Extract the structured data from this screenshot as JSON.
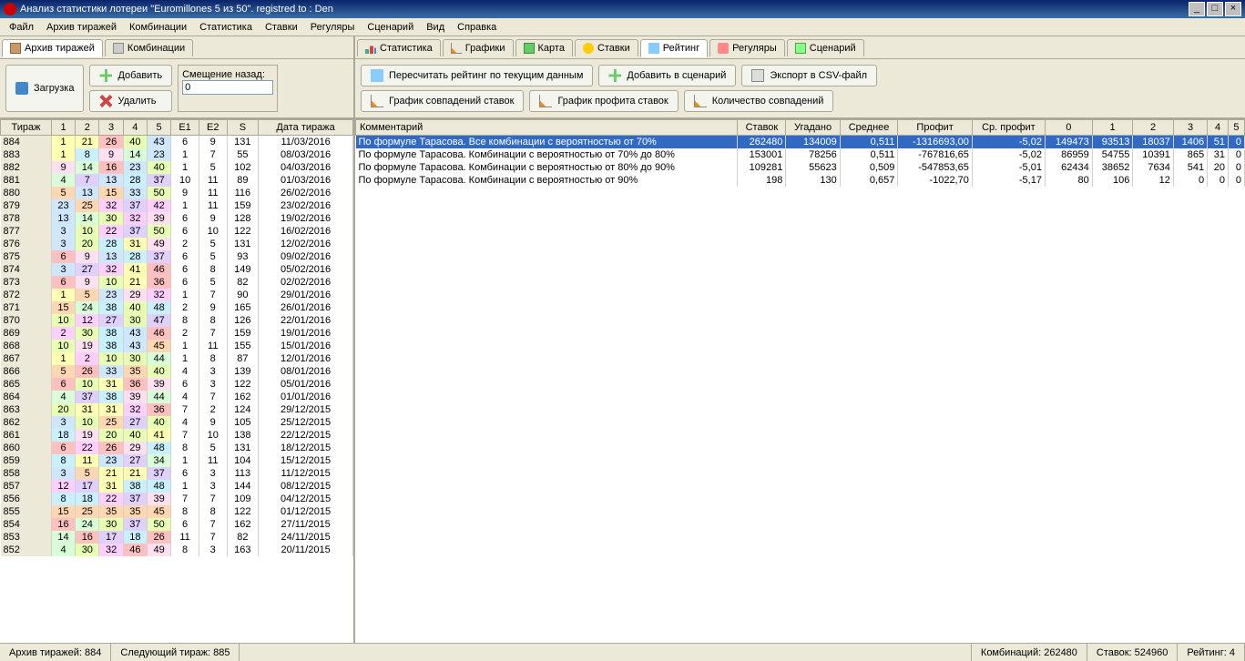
{
  "window": {
    "title": "Анализ статистики лотереи \"Euromillones 5 из 50\". registred to : Den",
    "min": "_",
    "max": "□",
    "close": "×"
  },
  "menu": [
    "Файл",
    "Архив тиражей",
    "Комбинации",
    "Статистика",
    "Ставки",
    "Регуляры",
    "Сценарий",
    "Вид",
    "Справка"
  ],
  "leftTabs": [
    {
      "label": "Архив тиражей",
      "icon": "i-arch"
    },
    {
      "label": "Комбинации",
      "icon": "i-comb"
    }
  ],
  "rightTabs": [
    {
      "label": "Статистика",
      "icon": "i-stat"
    },
    {
      "label": "Графики",
      "icon": "i-graph"
    },
    {
      "label": "Карта",
      "icon": "i-map"
    },
    {
      "label": "Ставки",
      "icon": "i-bet"
    },
    {
      "label": "Рейтинг",
      "icon": "i-rate",
      "active": true
    },
    {
      "label": "Регуляры",
      "icon": "i-reg"
    },
    {
      "label": "Сценарий",
      "icon": "i-scen"
    }
  ],
  "leftButtons": {
    "load": "Загрузка",
    "add": "Добавить",
    "del": "Удалить",
    "offsetLabel": "Смещение назад:",
    "offsetValue": "0"
  },
  "rightButtonsRow1": [
    {
      "label": "Пересчитать рейтинг по текущим данным",
      "icon": "i-rate"
    },
    {
      "label": "Добавить в сценарий",
      "icon": "i-add"
    },
    {
      "label": "Экспорт в CSV-файл",
      "icon": "i-exp"
    }
  ],
  "rightButtonsRow2": [
    {
      "label": "График совпадений ставок",
      "icon": "i-graph"
    },
    {
      "label": "График профита ставок",
      "icon": "i-graph"
    },
    {
      "label": "Количество совпадений",
      "icon": "i-graph"
    }
  ],
  "drawHeaders": [
    "Тираж",
    "1",
    "2",
    "3",
    "4",
    "5",
    "E1",
    "E2",
    "S",
    "Дата тиража"
  ],
  "draws": [
    [
      884,
      1,
      21,
      26,
      40,
      43,
      6,
      9,
      131,
      "11/03/2016"
    ],
    [
      883,
      1,
      8,
      9,
      14,
      23,
      1,
      7,
      55,
      "08/03/2016"
    ],
    [
      882,
      9,
      14,
      16,
      23,
      40,
      1,
      5,
      102,
      "04/03/2016"
    ],
    [
      881,
      4,
      7,
      13,
      28,
      37,
      10,
      11,
      89,
      "01/03/2016"
    ],
    [
      880,
      5,
      13,
      15,
      33,
      50,
      9,
      11,
      116,
      "26/02/2016"
    ],
    [
      879,
      23,
      25,
      32,
      37,
      42,
      1,
      11,
      159,
      "23/02/2016"
    ],
    [
      878,
      13,
      14,
      30,
      32,
      39,
      6,
      9,
      128,
      "19/02/2016"
    ],
    [
      877,
      3,
      10,
      22,
      37,
      50,
      6,
      10,
      122,
      "16/02/2016"
    ],
    [
      876,
      3,
      20,
      28,
      31,
      49,
      2,
      5,
      131,
      "12/02/2016"
    ],
    [
      875,
      6,
      9,
      13,
      28,
      37,
      6,
      5,
      93,
      "09/02/2016"
    ],
    [
      874,
      3,
      27,
      32,
      41,
      46,
      6,
      8,
      149,
      "05/02/2016"
    ],
    [
      873,
      6,
      9,
      10,
      21,
      36,
      6,
      5,
      82,
      "02/02/2016"
    ],
    [
      872,
      1,
      5,
      23,
      29,
      32,
      1,
      7,
      90,
      "29/01/2016"
    ],
    [
      871,
      15,
      24,
      38,
      40,
      48,
      2,
      9,
      165,
      "26/01/2016"
    ],
    [
      870,
      10,
      12,
      27,
      30,
      47,
      8,
      8,
      126,
      "22/01/2016"
    ],
    [
      869,
      2,
      30,
      38,
      43,
      46,
      2,
      7,
      159,
      "19/01/2016"
    ],
    [
      868,
      10,
      19,
      38,
      43,
      45,
      1,
      11,
      155,
      "15/01/2016"
    ],
    [
      867,
      1,
      2,
      10,
      30,
      44,
      1,
      8,
      87,
      "12/01/2016"
    ],
    [
      866,
      5,
      26,
      33,
      35,
      40,
      4,
      3,
      139,
      "08/01/2016"
    ],
    [
      865,
      6,
      10,
      31,
      36,
      39,
      6,
      3,
      122,
      "05/01/2016"
    ],
    [
      864,
      4,
      37,
      38,
      39,
      44,
      4,
      7,
      162,
      "01/01/2016"
    ],
    [
      863,
      20,
      31,
      31,
      32,
      36,
      7,
      2,
      124,
      "29/12/2015"
    ],
    [
      862,
      3,
      10,
      25,
      27,
      40,
      4,
      9,
      105,
      "25/12/2015"
    ],
    [
      861,
      18,
      19,
      20,
      40,
      41,
      7,
      10,
      138,
      "22/12/2015"
    ],
    [
      860,
      6,
      22,
      26,
      29,
      48,
      8,
      5,
      131,
      "18/12/2015"
    ],
    [
      859,
      8,
      11,
      23,
      27,
      34,
      1,
      11,
      104,
      "15/12/2015"
    ],
    [
      858,
      3,
      5,
      21,
      21,
      37,
      6,
      3,
      113,
      "11/12/2015"
    ],
    [
      857,
      12,
      17,
      31,
      38,
      48,
      1,
      3,
      144,
      "08/12/2015"
    ],
    [
      856,
      8,
      18,
      22,
      37,
      39,
      7,
      7,
      109,
      "04/12/2015"
    ],
    [
      855,
      15,
      25,
      35,
      35,
      45,
      8,
      8,
      122,
      "01/12/2015"
    ],
    [
      854,
      16,
      24,
      30,
      37,
      50,
      6,
      7,
      162,
      "27/11/2015"
    ],
    [
      853,
      14,
      16,
      17,
      18,
      26,
      11,
      7,
      82,
      "24/11/2015"
    ],
    [
      852,
      4,
      30,
      32,
      46,
      49,
      8,
      3,
      163,
      "20/11/2015"
    ]
  ],
  "ratingHeaders": [
    "Комментарий",
    "Ставок",
    "Угадано",
    "Среднее",
    "Профит",
    "Ср. профит",
    "0",
    "1",
    "2",
    "3",
    "4",
    "5"
  ],
  "ratings": [
    {
      "sel": true,
      "cells": [
        "По формуле Тарасова. Все комбинации с вероятностью от 70%",
        "262480",
        "134009",
        "0,511",
        "-1316693,00",
        "-5,02",
        "149473",
        "93513",
        "18037",
        "1406",
        "51",
        "0"
      ]
    },
    {
      "sel": false,
      "cells": [
        "По формуле Тарасова. Комбинации с вероятностью от 70% до 80%",
        "153001",
        "78256",
        "0,511",
        "-767816,65",
        "-5,02",
        "86959",
        "54755",
        "10391",
        "865",
        "31",
        "0"
      ]
    },
    {
      "sel": false,
      "cells": [
        "По формуле Тарасова. Комбинации с вероятностью от 80% до 90%",
        "109281",
        "55623",
        "0,509",
        "-547853,65",
        "-5,01",
        "62434",
        "38652",
        "7634",
        "541",
        "20",
        "0"
      ]
    },
    {
      "sel": false,
      "cells": [
        "По формуле Тарасова. Комбинации с вероятностью от 90%",
        "198",
        "130",
        "0,657",
        "-1022,70",
        "-5,17",
        "80",
        "106",
        "12",
        "0",
        "0",
        "0"
      ]
    }
  ],
  "status": {
    "arch": "Архив тиражей: 884",
    "next": "Следующий тираж: 885",
    "comb": "Комбинаций: 262480",
    "bets": "Ставок: 524960",
    "rate": "Рейтинг: 4"
  }
}
